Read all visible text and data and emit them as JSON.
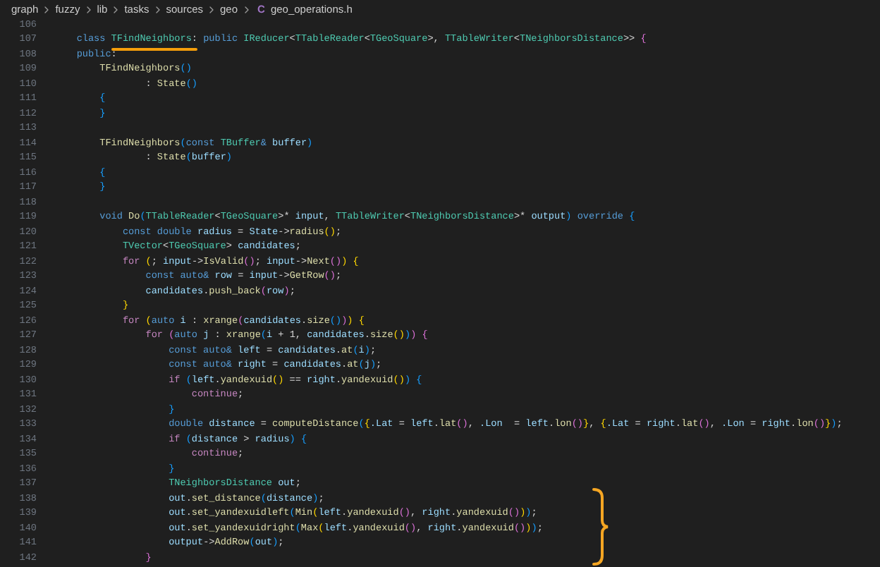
{
  "breadcrumb": {
    "folders": [
      "graph",
      "fuzzy",
      "lib",
      "tasks",
      "sources",
      "geo"
    ],
    "file_icon": "C",
    "file": "geo_operations.h"
  },
  "lines": [
    {
      "number": "106"
    },
    {
      "number": "107",
      "tokens": [
        {
          "text": "    class ",
          "kind": "keyword"
        },
        {
          "text": "TFindNeighbors",
          "kind": "type",
          "underlined": true
        },
        {
          "text": ": ",
          "kind": "plain"
        },
        {
          "text": "public ",
          "kind": "keyword"
        },
        {
          "text": "IReducer",
          "kind": "type"
        },
        {
          "text": "<",
          "kind": "plain"
        },
        {
          "text": "TTableReader",
          "kind": "type"
        },
        {
          "text": "<",
          "kind": "plain"
        },
        {
          "text": "TGeoSquare",
          "kind": "type"
        },
        {
          "text": ">, ",
          "kind": "plain"
        },
        {
          "text": "TTableWriter",
          "kind": "type"
        },
        {
          "text": "<",
          "kind": "plain"
        },
        {
          "text": "TNeighborsDistance",
          "kind": "type"
        },
        {
          "text": ">> ",
          "kind": "plain"
        },
        {
          "text": "{",
          "kind": "bracket2"
        }
      ]
    },
    {
      "number": "108",
      "tokens": [
        {
          "text": "    public",
          "kind": "keyword"
        },
        {
          "text": ":",
          "kind": "plain"
        }
      ]
    },
    {
      "number": "109",
      "tokens": [
        {
          "text": "        TFindNeighbors",
          "kind": "function"
        },
        {
          "text": "()",
          "kind": "bracket3"
        }
      ]
    },
    {
      "number": "110",
      "tokens": [
        {
          "text": "                : ",
          "kind": "plain"
        },
        {
          "text": "State",
          "kind": "function"
        },
        {
          "text": "()",
          "kind": "bracket3"
        }
      ]
    },
    {
      "number": "111",
      "tokens": [
        {
          "text": "        {",
          "kind": "bracket3"
        }
      ]
    },
    {
      "number": "112",
      "tokens": [
        {
          "text": "        }",
          "kind": "bracket3"
        }
      ]
    },
    {
      "number": "113"
    },
    {
      "number": "114",
      "tokens": [
        {
          "text": "        TFindNeighbors",
          "kind": "function"
        },
        {
          "text": "(",
          "kind": "bracket3"
        },
        {
          "text": "const ",
          "kind": "keyword"
        },
        {
          "text": "TBuffer",
          "kind": "type"
        },
        {
          "text": "& ",
          "kind": "keyword"
        },
        {
          "text": "buffer",
          "kind": "variable"
        },
        {
          "text": ")",
          "kind": "bracket3"
        }
      ]
    },
    {
      "number": "115",
      "tokens": [
        {
          "text": "                : ",
          "kind": "plain"
        },
        {
          "text": "State",
          "kind": "function"
        },
        {
          "text": "(",
          "kind": "bracket3"
        },
        {
          "text": "buffer",
          "kind": "variable"
        },
        {
          "text": ")",
          "kind": "bracket3"
        }
      ]
    },
    {
      "number": "116",
      "tokens": [
        {
          "text": "        {",
          "kind": "bracket3"
        }
      ]
    },
    {
      "number": "117",
      "tokens": [
        {
          "text": "        }",
          "kind": "bracket3"
        }
      ]
    },
    {
      "number": "118"
    },
    {
      "number": "119",
      "tokens": [
        {
          "text": "        void ",
          "kind": "keyword"
        },
        {
          "text": "Do",
          "kind": "function"
        },
        {
          "text": "(",
          "kind": "bracket3"
        },
        {
          "text": "TTableReader",
          "kind": "type"
        },
        {
          "text": "<",
          "kind": "plain"
        },
        {
          "text": "TGeoSquare",
          "kind": "type"
        },
        {
          "text": ">* ",
          "kind": "plain"
        },
        {
          "text": "input",
          "kind": "variable"
        },
        {
          "text": ", ",
          "kind": "plain"
        },
        {
          "text": "TTableWriter",
          "kind": "type"
        },
        {
          "text": "<",
          "kind": "plain"
        },
        {
          "text": "TNeighborsDistance",
          "kind": "type"
        },
        {
          "text": ">* ",
          "kind": "plain"
        },
        {
          "text": "output",
          "kind": "variable"
        },
        {
          "text": ")",
          "kind": "bracket3"
        },
        {
          "text": " override ",
          "kind": "keyword"
        },
        {
          "text": "{",
          "kind": "bracket3"
        }
      ]
    },
    {
      "number": "120",
      "tokens": [
        {
          "text": "            const double ",
          "kind": "keyword"
        },
        {
          "text": "radius",
          "kind": "variable"
        },
        {
          "text": " = ",
          "kind": "plain"
        },
        {
          "text": "State",
          "kind": "variable"
        },
        {
          "text": "->",
          "kind": "plain"
        },
        {
          "text": "radius",
          "kind": "function"
        },
        {
          "text": "()",
          "kind": "bracket1"
        },
        {
          "text": ";",
          "kind": "plain"
        }
      ]
    },
    {
      "number": "121",
      "tokens": [
        {
          "text": "            TVector",
          "kind": "type"
        },
        {
          "text": "<",
          "kind": "plain"
        },
        {
          "text": "TGeoSquare",
          "kind": "type"
        },
        {
          "text": "> ",
          "kind": "plain"
        },
        {
          "text": "candidates",
          "kind": "variable"
        },
        {
          "text": ";",
          "kind": "plain"
        }
      ]
    },
    {
      "number": "122",
      "tokens": [
        {
          "text": "            for ",
          "kind": "control"
        },
        {
          "text": "(",
          "kind": "bracket1"
        },
        {
          "text": "; ",
          "kind": "plain"
        },
        {
          "text": "input",
          "kind": "variable"
        },
        {
          "text": "->",
          "kind": "plain"
        },
        {
          "text": "IsValid",
          "kind": "function"
        },
        {
          "text": "()",
          "kind": "bracket2"
        },
        {
          "text": "; ",
          "kind": "plain"
        },
        {
          "text": "input",
          "kind": "variable"
        },
        {
          "text": "->",
          "kind": "plain"
        },
        {
          "text": "Next",
          "kind": "function"
        },
        {
          "text": "()",
          "kind": "bracket2"
        },
        {
          "text": ") {",
          "kind": "bracket1"
        }
      ]
    },
    {
      "number": "123",
      "tokens": [
        {
          "text": "                const auto",
          "kind": "keyword"
        },
        {
          "text": "& ",
          "kind": "keyword"
        },
        {
          "text": "row",
          "kind": "variable"
        },
        {
          "text": " = ",
          "kind": "plain"
        },
        {
          "text": "input",
          "kind": "variable"
        },
        {
          "text": "->",
          "kind": "plain"
        },
        {
          "text": "GetRow",
          "kind": "function"
        },
        {
          "text": "()",
          "kind": "bracket2"
        },
        {
          "text": ";",
          "kind": "plain"
        }
      ]
    },
    {
      "number": "124",
      "tokens": [
        {
          "text": "                candidates",
          "kind": "variable"
        },
        {
          "text": ".",
          "kind": "plain"
        },
        {
          "text": "push_back",
          "kind": "function"
        },
        {
          "text": "(",
          "kind": "bracket2"
        },
        {
          "text": "row",
          "kind": "variable"
        },
        {
          "text": ")",
          "kind": "bracket2"
        },
        {
          "text": ";",
          "kind": "plain"
        }
      ]
    },
    {
      "number": "125",
      "tokens": [
        {
          "text": "            }",
          "kind": "bracket1"
        }
      ]
    },
    {
      "number": "126",
      "tokens": [
        {
          "text": "            for ",
          "kind": "control"
        },
        {
          "text": "(",
          "kind": "bracket1"
        },
        {
          "text": "auto ",
          "kind": "keyword"
        },
        {
          "text": "i",
          "kind": "variable"
        },
        {
          "text": " : ",
          "kind": "plain"
        },
        {
          "text": "xrange",
          "kind": "function"
        },
        {
          "text": "(",
          "kind": "bracket2"
        },
        {
          "text": "candidates",
          "kind": "variable"
        },
        {
          "text": ".",
          "kind": "plain"
        },
        {
          "text": "size",
          "kind": "function"
        },
        {
          "text": "()",
          "kind": "bracket3"
        },
        {
          "text": ")",
          "kind": "bracket2"
        },
        {
          "text": ") {",
          "kind": "bracket1"
        }
      ]
    },
    {
      "number": "127",
      "tokens": [
        {
          "text": "                for ",
          "kind": "control"
        },
        {
          "text": "(",
          "kind": "bracket2"
        },
        {
          "text": "auto ",
          "kind": "keyword"
        },
        {
          "text": "j",
          "kind": "variable"
        },
        {
          "text": " : ",
          "kind": "plain"
        },
        {
          "text": "xrange",
          "kind": "function"
        },
        {
          "text": "(",
          "kind": "bracket3"
        },
        {
          "text": "i",
          "kind": "variable"
        },
        {
          "text": " + 1, ",
          "kind": "plain"
        },
        {
          "text": "candidates",
          "kind": "variable"
        },
        {
          "text": ".",
          "kind": "plain"
        },
        {
          "text": "size",
          "kind": "function"
        },
        {
          "text": "()",
          "kind": "bracket1"
        },
        {
          "text": ")",
          "kind": "bracket3"
        },
        {
          "text": ") {",
          "kind": "bracket2"
        }
      ]
    },
    {
      "number": "128",
      "tokens": [
        {
          "text": "                    const auto",
          "kind": "keyword"
        },
        {
          "text": "& ",
          "kind": "keyword"
        },
        {
          "text": "left",
          "kind": "variable"
        },
        {
          "text": " = ",
          "kind": "plain"
        },
        {
          "text": "candidates",
          "kind": "variable"
        },
        {
          "text": ".",
          "kind": "plain"
        },
        {
          "text": "at",
          "kind": "function"
        },
        {
          "text": "(",
          "kind": "bracket3"
        },
        {
          "text": "i",
          "kind": "variable"
        },
        {
          "text": ")",
          "kind": "bracket3"
        },
        {
          "text": ";",
          "kind": "plain"
        }
      ]
    },
    {
      "number": "129",
      "tokens": [
        {
          "text": "                    const auto",
          "kind": "keyword"
        },
        {
          "text": "& ",
          "kind": "keyword"
        },
        {
          "text": "right",
          "kind": "variable"
        },
        {
          "text": " = ",
          "kind": "plain"
        },
        {
          "text": "candidates",
          "kind": "variable"
        },
        {
          "text": ".",
          "kind": "plain"
        },
        {
          "text": "at",
          "kind": "function"
        },
        {
          "text": "(",
          "kind": "bracket3"
        },
        {
          "text": "j",
          "kind": "variable"
        },
        {
          "text": ")",
          "kind": "bracket3"
        },
        {
          "text": ";",
          "kind": "plain"
        }
      ]
    },
    {
      "number": "130",
      "tokens": [
        {
          "text": "                    if ",
          "kind": "control"
        },
        {
          "text": "(",
          "kind": "bracket3"
        },
        {
          "text": "left",
          "kind": "variable"
        },
        {
          "text": ".",
          "kind": "plain"
        },
        {
          "text": "yandexuid",
          "kind": "function"
        },
        {
          "text": "()",
          "kind": "bracket1"
        },
        {
          "text": " == ",
          "kind": "plain"
        },
        {
          "text": "right",
          "kind": "variable"
        },
        {
          "text": ".",
          "kind": "plain"
        },
        {
          "text": "yandexuid",
          "kind": "function"
        },
        {
          "text": "()",
          "kind": "bracket1"
        },
        {
          "text": ") {",
          "kind": "bracket3"
        }
      ]
    },
    {
      "number": "131",
      "tokens": [
        {
          "text": "                        continue",
          "kind": "control"
        },
        {
          "text": ";",
          "kind": "plain"
        }
      ]
    },
    {
      "number": "132",
      "tokens": [
        {
          "text": "                    }",
          "kind": "bracket3"
        }
      ]
    },
    {
      "number": "133",
      "tokens": [
        {
          "text": "                    double ",
          "kind": "keyword"
        },
        {
          "text": "distance",
          "kind": "variable"
        },
        {
          "text": " = ",
          "kind": "plain"
        },
        {
          "text": "computeDistance",
          "kind": "function"
        },
        {
          "text": "(",
          "kind": "bracket3"
        },
        {
          "text": "{",
          "kind": "bracket1"
        },
        {
          "text": ".Lat",
          "kind": "variable"
        },
        {
          "text": " = ",
          "kind": "plain"
        },
        {
          "text": "left",
          "kind": "variable"
        },
        {
          "text": ".",
          "kind": "plain"
        },
        {
          "text": "lat",
          "kind": "function"
        },
        {
          "text": "()",
          "kind": "bracket2"
        },
        {
          "text": ", ",
          "kind": "plain"
        },
        {
          "text": ".Lon",
          "kind": "variable"
        },
        {
          "text": "  = ",
          "kind": "plain"
        },
        {
          "text": "left",
          "kind": "variable"
        },
        {
          "text": ".",
          "kind": "plain"
        },
        {
          "text": "lon",
          "kind": "function"
        },
        {
          "text": "()",
          "kind": "bracket2"
        },
        {
          "text": "}",
          "kind": "bracket1"
        },
        {
          "text": ", ",
          "kind": "plain"
        },
        {
          "text": "{",
          "kind": "bracket1"
        },
        {
          "text": ".Lat",
          "kind": "variable"
        },
        {
          "text": " = ",
          "kind": "plain"
        },
        {
          "text": "right",
          "kind": "variable"
        },
        {
          "text": ".",
          "kind": "plain"
        },
        {
          "text": "lat",
          "kind": "function"
        },
        {
          "text": "()",
          "kind": "bracket2"
        },
        {
          "text": ", ",
          "kind": "plain"
        },
        {
          "text": ".Lon",
          "kind": "variable"
        },
        {
          "text": " = ",
          "kind": "plain"
        },
        {
          "text": "right",
          "kind": "variable"
        },
        {
          "text": ".",
          "kind": "plain"
        },
        {
          "text": "lon",
          "kind": "function"
        },
        {
          "text": "()",
          "kind": "bracket2"
        },
        {
          "text": "}",
          "kind": "bracket1"
        },
        {
          "text": ")",
          "kind": "bracket3"
        },
        {
          "text": ";",
          "kind": "plain"
        }
      ]
    },
    {
      "number": "134",
      "tokens": [
        {
          "text": "                    if ",
          "kind": "control"
        },
        {
          "text": "(",
          "kind": "bracket3"
        },
        {
          "text": "distance",
          "kind": "variable"
        },
        {
          "text": " > ",
          "kind": "plain"
        },
        {
          "text": "radius",
          "kind": "variable"
        },
        {
          "text": ") {",
          "kind": "bracket3"
        }
      ]
    },
    {
      "number": "135",
      "tokens": [
        {
          "text": "                        continue",
          "kind": "control"
        },
        {
          "text": ";",
          "kind": "plain"
        }
      ]
    },
    {
      "number": "136",
      "tokens": [
        {
          "text": "                    }",
          "kind": "bracket3"
        }
      ]
    },
    {
      "number": "137",
      "tokens": [
        {
          "text": "                    TNeighborsDistance ",
          "kind": "type"
        },
        {
          "text": "out",
          "kind": "variable"
        },
        {
          "text": ";",
          "kind": "plain"
        }
      ]
    },
    {
      "number": "138",
      "tokens": [
        {
          "text": "                    out",
          "kind": "variable"
        },
        {
          "text": ".",
          "kind": "plain"
        },
        {
          "text": "set_distance",
          "kind": "function"
        },
        {
          "text": "(",
          "kind": "bracket3"
        },
        {
          "text": "distance",
          "kind": "variable"
        },
        {
          "text": ")",
          "kind": "bracket3"
        },
        {
          "text": ";",
          "kind": "plain"
        }
      ]
    },
    {
      "number": "139",
      "tokens": [
        {
          "text": "                    out",
          "kind": "variable"
        },
        {
          "text": ".",
          "kind": "plain"
        },
        {
          "text": "set_yandexuidleft",
          "kind": "function"
        },
        {
          "text": "(",
          "kind": "bracket3"
        },
        {
          "text": "Min",
          "kind": "function"
        },
        {
          "text": "(",
          "kind": "bracket1"
        },
        {
          "text": "left",
          "kind": "variable"
        },
        {
          "text": ".",
          "kind": "plain"
        },
        {
          "text": "yandexuid",
          "kind": "function"
        },
        {
          "text": "()",
          "kind": "bracket2"
        },
        {
          "text": ", ",
          "kind": "plain"
        },
        {
          "text": "right",
          "kind": "variable"
        },
        {
          "text": ".",
          "kind": "plain"
        },
        {
          "text": "yandexuid",
          "kind": "function"
        },
        {
          "text": "()",
          "kind": "bracket2"
        },
        {
          "text": ")",
          "kind": "bracket1"
        },
        {
          "text": ")",
          "kind": "bracket3"
        },
        {
          "text": ";",
          "kind": "plain"
        }
      ]
    },
    {
      "number": "140",
      "tokens": [
        {
          "text": "                    out",
          "kind": "variable"
        },
        {
          "text": ".",
          "kind": "plain"
        },
        {
          "text": "set_yandexuidright",
          "kind": "function"
        },
        {
          "text": "(",
          "kind": "bracket3"
        },
        {
          "text": "Max",
          "kind": "function"
        },
        {
          "text": "(",
          "kind": "bracket1"
        },
        {
          "text": "left",
          "kind": "variable"
        },
        {
          "text": ".",
          "kind": "plain"
        },
        {
          "text": "yandexuid",
          "kind": "function"
        },
        {
          "text": "()",
          "kind": "bracket2"
        },
        {
          "text": ", ",
          "kind": "plain"
        },
        {
          "text": "right",
          "kind": "variable"
        },
        {
          "text": ".",
          "kind": "plain"
        },
        {
          "text": "yandexuid",
          "kind": "function"
        },
        {
          "text": "()",
          "kind": "bracket2"
        },
        {
          "text": ")",
          "kind": "bracket1"
        },
        {
          "text": ")",
          "kind": "bracket3"
        },
        {
          "text": ";",
          "kind": "plain"
        }
      ]
    },
    {
      "number": "141",
      "tokens": [
        {
          "text": "                    output",
          "kind": "variable"
        },
        {
          "text": "->",
          "kind": "plain"
        },
        {
          "text": "AddRow",
          "kind": "function"
        },
        {
          "text": "(",
          "kind": "bracket3"
        },
        {
          "text": "out",
          "kind": "variable"
        },
        {
          "text": ")",
          "kind": "bracket3"
        },
        {
          "text": ";",
          "kind": "plain"
        }
      ]
    },
    {
      "number": "142",
      "tokens": [
        {
          "text": "                }",
          "kind": "bracket2"
        }
      ]
    }
  ]
}
